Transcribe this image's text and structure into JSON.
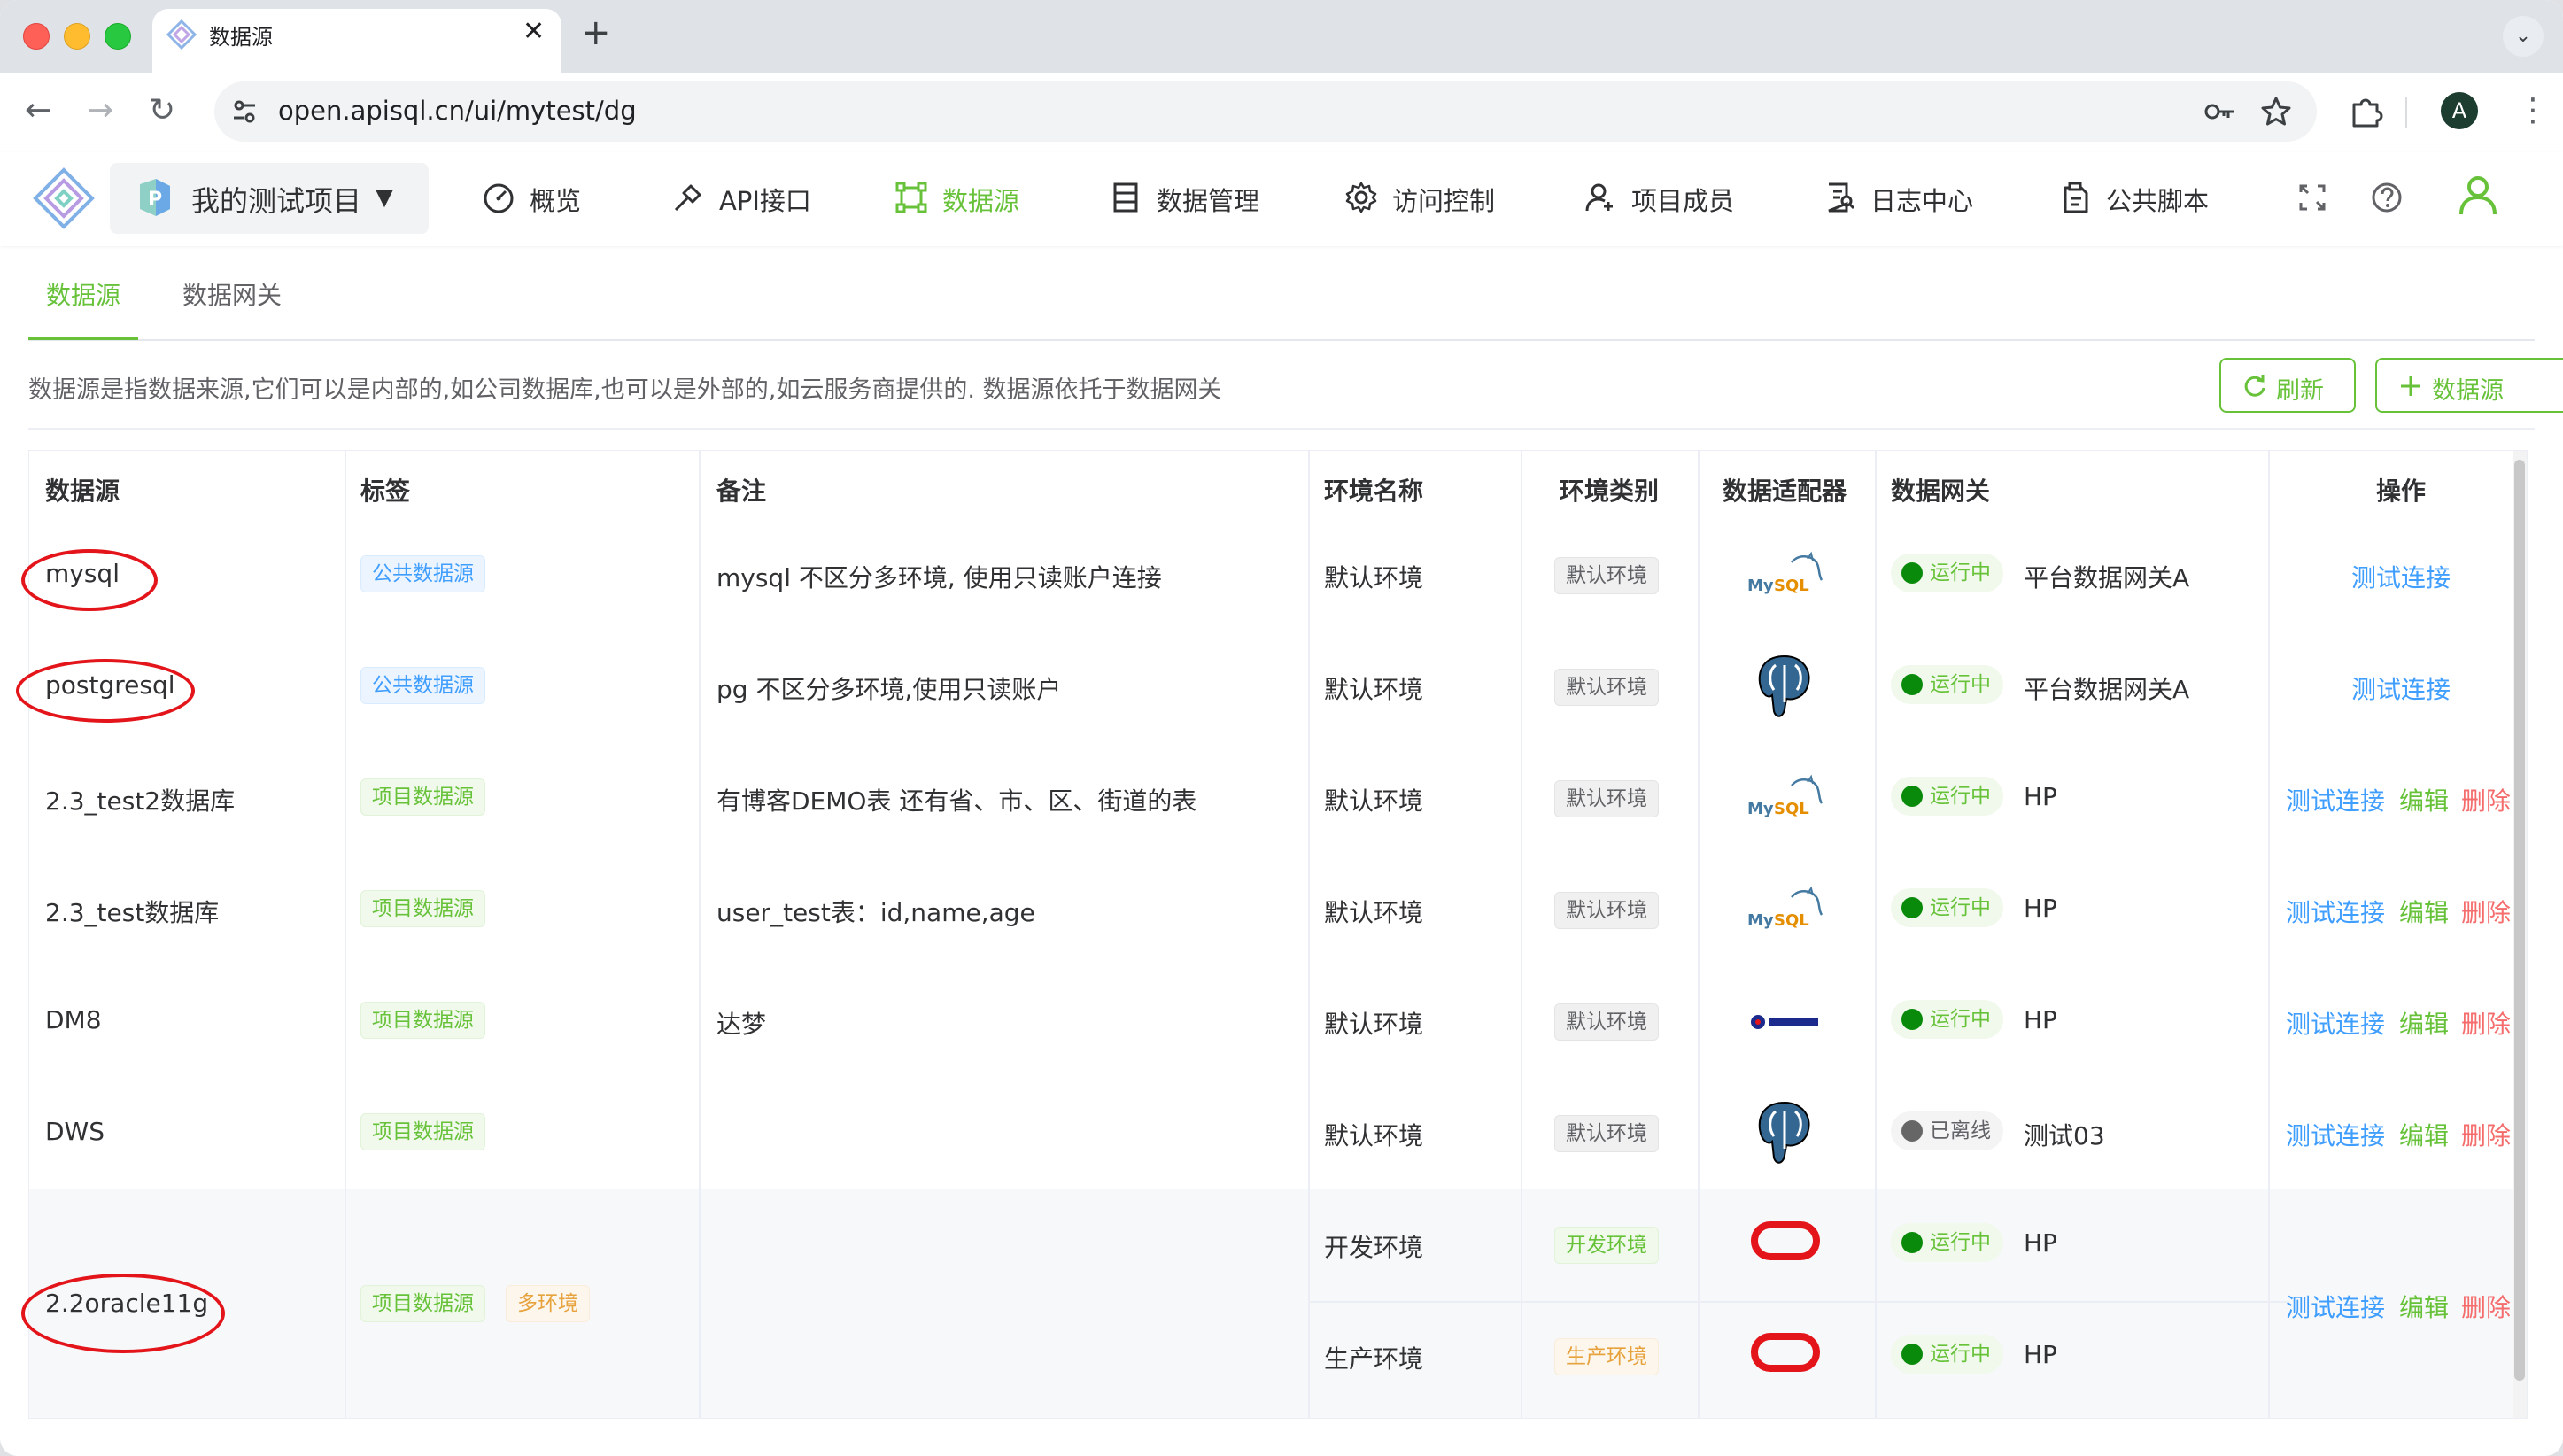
{
  "browser": {
    "tab_title": "数据源",
    "new_tab": "+",
    "close": "✕",
    "url": "open.apisql.cn/ui/mytest/dg",
    "profile_initial": "A"
  },
  "header": {
    "project_name": "我的测试项目",
    "menu": [
      {
        "label": "概览",
        "icon": "dashboard-icon"
      },
      {
        "label": "API接口",
        "icon": "api-icon"
      },
      {
        "label": "数据源",
        "icon": "datasource-icon"
      },
      {
        "label": "数据管理",
        "icon": "data-manage-icon"
      },
      {
        "label": "访问控制",
        "icon": "gear-icon"
      },
      {
        "label": "项目成员",
        "icon": "member-icon"
      },
      {
        "label": "日志中心",
        "icon": "log-icon"
      },
      {
        "label": "公共脚本",
        "icon": "script-icon"
      }
    ],
    "accent": "#67c23a"
  },
  "page_tabs": [
    "数据源",
    "数据网关"
  ],
  "description": "数据源是指数据来源,它们可以是内部的,如公司数据库,也可以是外部的,如云服务商提供的. 数据源依托于数据网关",
  "buttons": {
    "refresh": "刷新",
    "add": "数据源"
  },
  "table": {
    "headers": [
      "数据源",
      "标签",
      "备注",
      "环境名称",
      "环境类别",
      "数据适配器",
      "数据网关",
      "操作"
    ],
    "rows": [
      {
        "name": "mysql",
        "tags": [
          {
            "label": "公共数据源",
            "style": "blue"
          }
        ],
        "remark": "mysql 不区分多环境, 使用只读账户连接",
        "envs": [
          {
            "env_name": "默认环境",
            "env_type": "默认环境",
            "env_style": "gray",
            "adapter": "mysql-logo",
            "status": "运行中",
            "online": true,
            "gateway": "平台数据网关A"
          }
        ],
        "actions": [
          "测试连接"
        ]
      },
      {
        "name": "postgresql",
        "tags": [
          {
            "label": "公共数据源",
            "style": "blue"
          }
        ],
        "remark": "pg 不区分多环境,使用只读账户",
        "envs": [
          {
            "env_name": "默认环境",
            "env_type": "默认环境",
            "env_style": "gray",
            "adapter": "postgresql-logo",
            "status": "运行中",
            "online": true,
            "gateway": "平台数据网关A"
          }
        ],
        "actions": [
          "测试连接"
        ]
      },
      {
        "name": "2.3_test2数据库",
        "tags": [
          {
            "label": "项目数据源",
            "style": "green"
          }
        ],
        "remark": "有博客DEMO表 还有省、市、区、街道的表",
        "envs": [
          {
            "env_name": "默认环境",
            "env_type": "默认环境",
            "env_style": "gray",
            "adapter": "mysql-logo",
            "status": "运行中",
            "online": true,
            "gateway": "HP"
          }
        ],
        "actions": [
          "测试连接",
          "编辑",
          "删除"
        ]
      },
      {
        "name": "2.3_test数据库",
        "tags": [
          {
            "label": "项目数据源",
            "style": "green"
          }
        ],
        "remark": "user_test表：id,name,age",
        "envs": [
          {
            "env_name": "默认环境",
            "env_type": "默认环境",
            "env_style": "gray",
            "adapter": "mysql-logo",
            "status": "运行中",
            "online": true,
            "gateway": "HP"
          }
        ],
        "actions": [
          "测试连接",
          "编辑",
          "删除"
        ]
      },
      {
        "name": "DM8",
        "tags": [
          {
            "label": "项目数据源",
            "style": "green"
          }
        ],
        "remark": "达梦",
        "envs": [
          {
            "env_name": "默认环境",
            "env_type": "默认环境",
            "env_style": "gray",
            "adapter": "dameng-logo",
            "status": "运行中",
            "online": true,
            "gateway": "HP"
          }
        ],
        "actions": [
          "测试连接",
          "编辑",
          "删除"
        ]
      },
      {
        "name": "DWS",
        "tags": [
          {
            "label": "项目数据源",
            "style": "green"
          }
        ],
        "remark": "",
        "envs": [
          {
            "env_name": "默认环境",
            "env_type": "默认环境",
            "env_style": "gray",
            "adapter": "postgresql-logo",
            "status": "已离线",
            "online": false,
            "gateway": "测试03"
          }
        ],
        "actions": [
          "测试连接",
          "编辑",
          "删除"
        ]
      },
      {
        "name": "2.2oracle11g",
        "tags": [
          {
            "label": "项目数据源",
            "style": "green"
          },
          {
            "label": "多环境",
            "style": "orange"
          }
        ],
        "remark": "",
        "envs": [
          {
            "env_name": "开发环境",
            "env_type": "开发环境",
            "env_style": "green",
            "adapter": "oracle-logo",
            "status": "运行中",
            "online": true,
            "gateway": "HP"
          },
          {
            "env_name": "生产环境",
            "env_type": "生产环境",
            "env_style": "orange",
            "adapter": "oracle-logo",
            "status": "运行中",
            "online": true,
            "gateway": "HP"
          }
        ],
        "actions": [
          "测试连接",
          "编辑",
          "删除"
        ]
      }
    ]
  },
  "annotations": {
    "highlighted_rows": [
      "mysql",
      "postgresql",
      "2.2oracle11g"
    ],
    "color": "#e3151a"
  }
}
